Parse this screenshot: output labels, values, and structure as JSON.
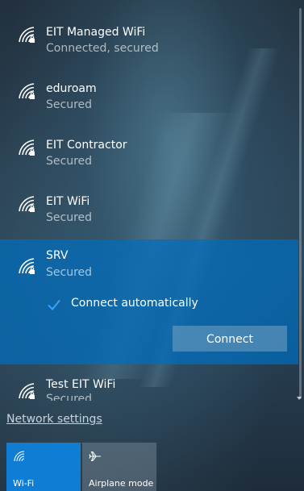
{
  "networks": [
    {
      "name": "EIT Managed WiFi",
      "status": "Connected, secured",
      "icon": "wifi-secured-icon"
    },
    {
      "name": "eduroam",
      "status": "Secured",
      "icon": "wifi-secured-icon"
    },
    {
      "name": "EIT Contractor",
      "status": "Secured",
      "icon": "wifi-secured-icon"
    },
    {
      "name": "EIT WiFi",
      "status": "Secured",
      "icon": "wifi-secured-icon"
    },
    {
      "name": "SRV",
      "status": "Secured",
      "icon": "wifi-secured-icon",
      "selected": true
    },
    {
      "name": "Test EIT WiFi",
      "status": "Secured",
      "icon": "wifi-secured-icon"
    }
  ],
  "selected_network": {
    "auto_connect_label": "Connect automatically",
    "auto_connect_checked": true,
    "connect_button_label": "Connect"
  },
  "network_settings_link": "Network settings",
  "quick_actions": {
    "wifi_label": "Wi-Fi",
    "wifi_icon": "wifi-icon",
    "wifi_on": true,
    "airplane_label": "Airplane mode",
    "airplane_icon": "airplane-icon",
    "airplane_on": false
  },
  "colors": {
    "accent": "#0f7dd4",
    "selected_row": "#006ebe",
    "check_accent": "#3aa0ff"
  }
}
